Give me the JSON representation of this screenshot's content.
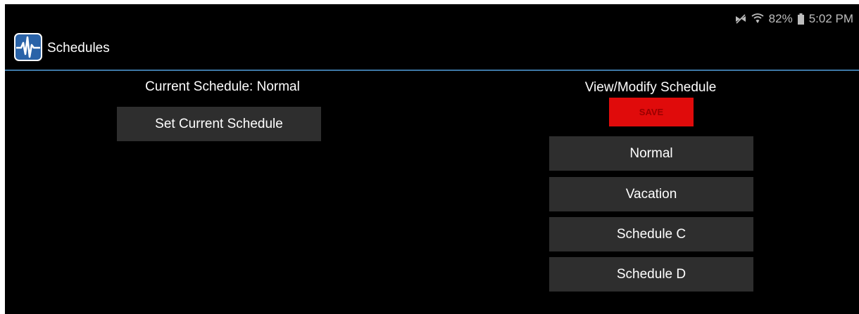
{
  "status_bar": {
    "battery_percent": "82%",
    "time": "5:02 PM",
    "icons": [
      "mute-icon",
      "wifi-icon",
      "battery-icon"
    ]
  },
  "app_bar": {
    "title": "Schedules",
    "logo_icon": "pulse-wave-logo-icon",
    "divider_color": "#3d78a6"
  },
  "left_panel": {
    "current_schedule_label": "Current Schedule: Normal",
    "set_current_button": "Set Current Schedule"
  },
  "right_panel": {
    "heading": "View/Modify Schedule",
    "save_button": "SAVE",
    "save_color": "#e00b0b",
    "schedules": [
      "Normal",
      "Vacation",
      "Schedule C",
      "Schedule D"
    ]
  }
}
